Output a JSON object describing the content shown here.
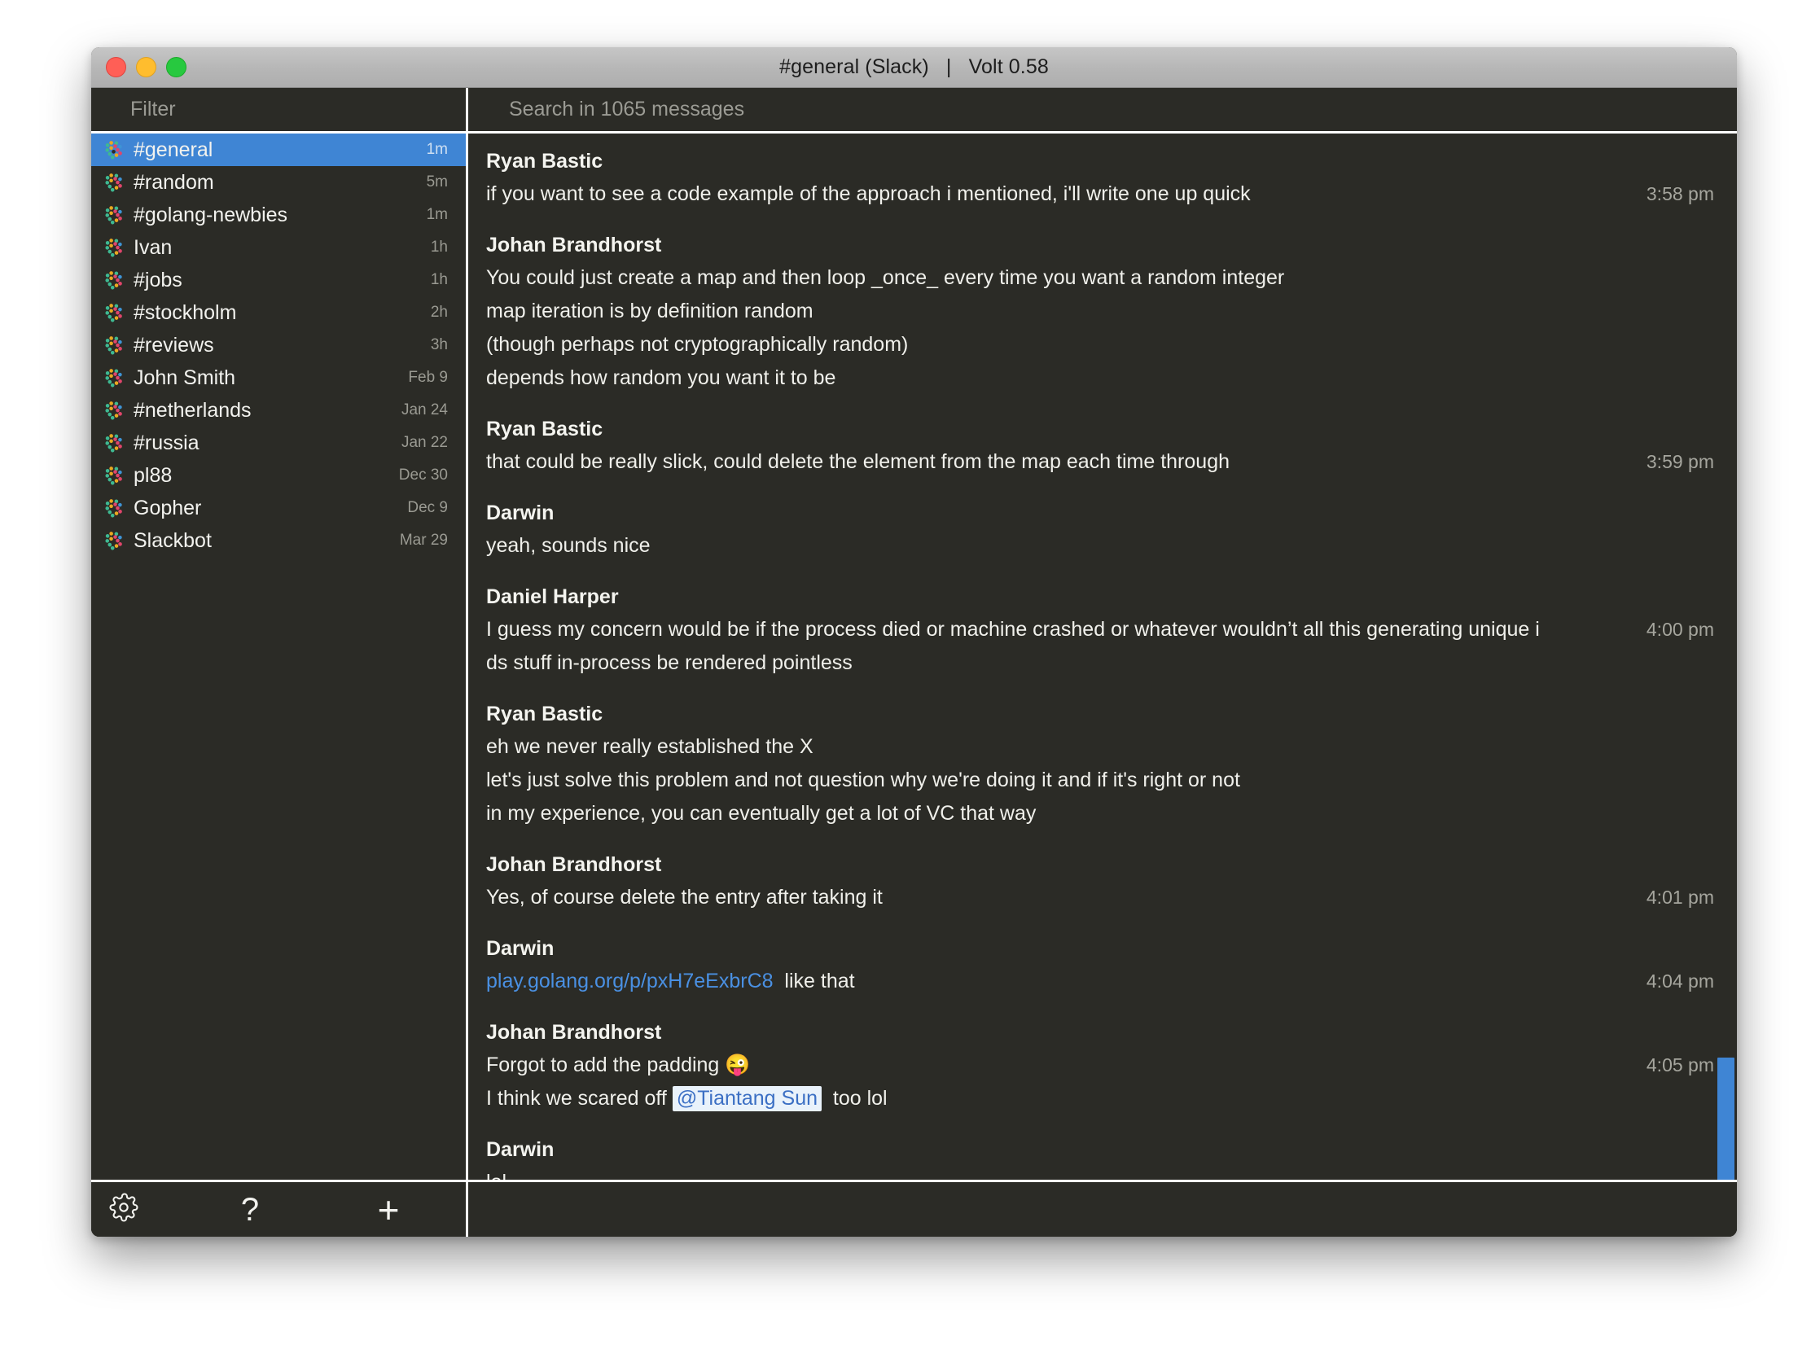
{
  "window": {
    "title": "#general (Slack)   |   Volt 0.58",
    "traffic": {
      "close": "close-button",
      "minimize": "minimize-button",
      "maximize": "maximize-button"
    }
  },
  "sidebar": {
    "filter_placeholder": "Filter",
    "items": [
      {
        "name": "#general",
        "time": "1m",
        "selected": true
      },
      {
        "name": "#random",
        "time": "5m",
        "selected": false
      },
      {
        "name": "#golang-newbies",
        "time": "1m",
        "selected": false
      },
      {
        "name": "Ivan",
        "time": "1h",
        "selected": false
      },
      {
        "name": "#jobs",
        "time": "1h",
        "selected": false
      },
      {
        "name": "#stockholm",
        "time": "2h",
        "selected": false
      },
      {
        "name": "#reviews",
        "time": "3h",
        "selected": false
      },
      {
        "name": "John Smith",
        "time": "Feb 9",
        "selected": false
      },
      {
        "name": "#netherlands",
        "time": "Jan 24",
        "selected": false
      },
      {
        "name": "#russia",
        "time": "Jan 22",
        "selected": false
      },
      {
        "name": "pl88",
        "time": "Dec 30",
        "selected": false
      },
      {
        "name": "Gopher",
        "time": "Dec 9",
        "selected": false
      },
      {
        "name": "Slackbot",
        "time": "Mar 29",
        "selected": false
      }
    ]
  },
  "toolbar": {
    "settings_label": "settings",
    "help_label": "?",
    "add_label": "+"
  },
  "main": {
    "search_placeholder": "Search in 1065 messages",
    "messages": [
      {
        "author": "Ryan Bastic",
        "time": "3:58 pm",
        "lines": [
          {
            "text": "if you want to see a code example of the approach i mentioned, i'll write one up quick"
          }
        ]
      },
      {
        "author": "Johan Brandhorst",
        "time": "",
        "lines": [
          {
            "text": "You could just create a map and then loop _once_ every time you want a random integer"
          },
          {
            "text": "map iteration is by definition random"
          },
          {
            "text": "(though perhaps not cryptographically random)"
          },
          {
            "text": "depends how random you want it to be"
          }
        ]
      },
      {
        "author": "Ryan Bastic",
        "time": "3:59 pm",
        "lines": [
          {
            "text": "that could be really slick, could delete the element from the map each time through"
          }
        ]
      },
      {
        "author": "Darwin",
        "time": "",
        "lines": [
          {
            "text": "yeah, sounds nice"
          }
        ]
      },
      {
        "author": "Daniel Harper",
        "time": "4:00 pm",
        "lines": [
          {
            "text": "I guess my concern would be if the process died or machine crashed or whatever wouldn’t all this generating unique i"
          },
          {
            "text": "ds stuff in-process be rendered pointless"
          }
        ]
      },
      {
        "author": "Ryan Bastic",
        "time": "",
        "lines": [
          {
            "text": "eh we never really established the X"
          },
          {
            "text": "let's just solve this problem and not question why we're doing it and if it's right or not"
          },
          {
            "text": "in my experience, you can eventually get a lot of VC that way"
          }
        ]
      },
      {
        "author": "Johan Brandhorst",
        "time": "4:01 pm",
        "lines": [
          {
            "text": "Yes, of course delete the entry after taking it"
          }
        ]
      },
      {
        "author": "Darwin",
        "time": "4:04 pm",
        "lines": [
          {
            "link": "play.golang.org/p/pxH7eExbrC8",
            "text": "  like that"
          }
        ]
      },
      {
        "author": "Johan Brandhorst",
        "time": "4:05 pm",
        "lines": [
          {
            "text": "Forgot to add the padding ",
            "emoji": "😜"
          },
          {
            "text": "I think we scared off ",
            "mention": "@Tiantang Sun",
            "text_after": "  too lol"
          }
        ]
      },
      {
        "author": "Darwin",
        "time": "",
        "lines": [
          {
            "text": "lol"
          }
        ]
      }
    ],
    "scrollbar": {
      "color": "#3f85d4"
    }
  },
  "colors": {
    "window_bg": "#2b2b26",
    "selection": "#3f85d4",
    "link": "#4a90e2",
    "mention_bg": "#e9f2fb",
    "mention_fg": "#3b6fc4",
    "divider": "#ffffff",
    "muted_text": "#9a9a92"
  }
}
